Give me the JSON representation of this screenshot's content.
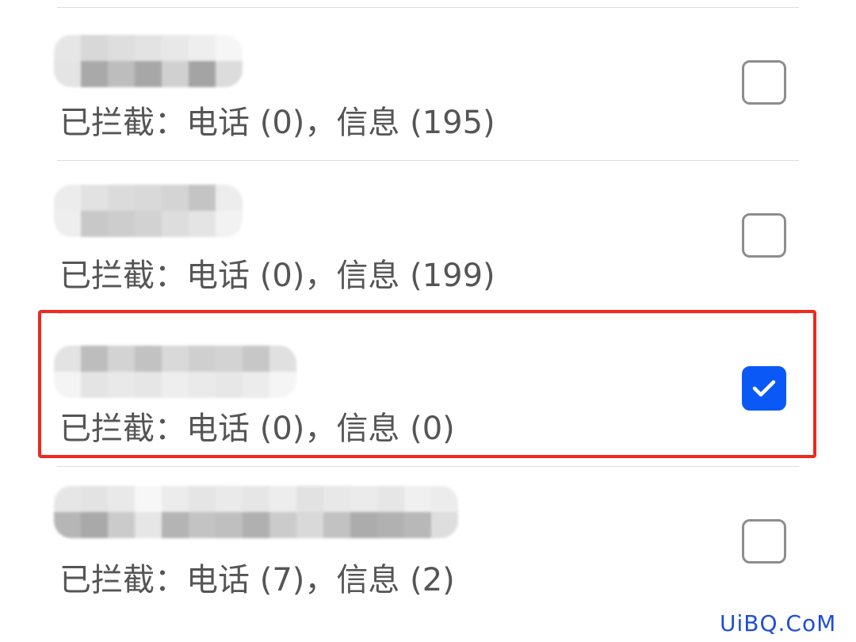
{
  "list": {
    "items": [
      {
        "subtitle": "已拦截：电话 (0)，信息 (195)",
        "checked": false
      },
      {
        "subtitle": "已拦截：电话 (0)，信息 (199)",
        "checked": false
      },
      {
        "subtitle": "已拦截：电话 (0)，信息 (0)",
        "checked": true
      },
      {
        "subtitle": "已拦截：电话 (7)，信息 (2)",
        "checked": false
      }
    ]
  },
  "watermark": "UiBQ.CoM",
  "colors": {
    "accent": "#0a59f7",
    "highlight": "#f0281e",
    "text_secondary": "#555555"
  }
}
